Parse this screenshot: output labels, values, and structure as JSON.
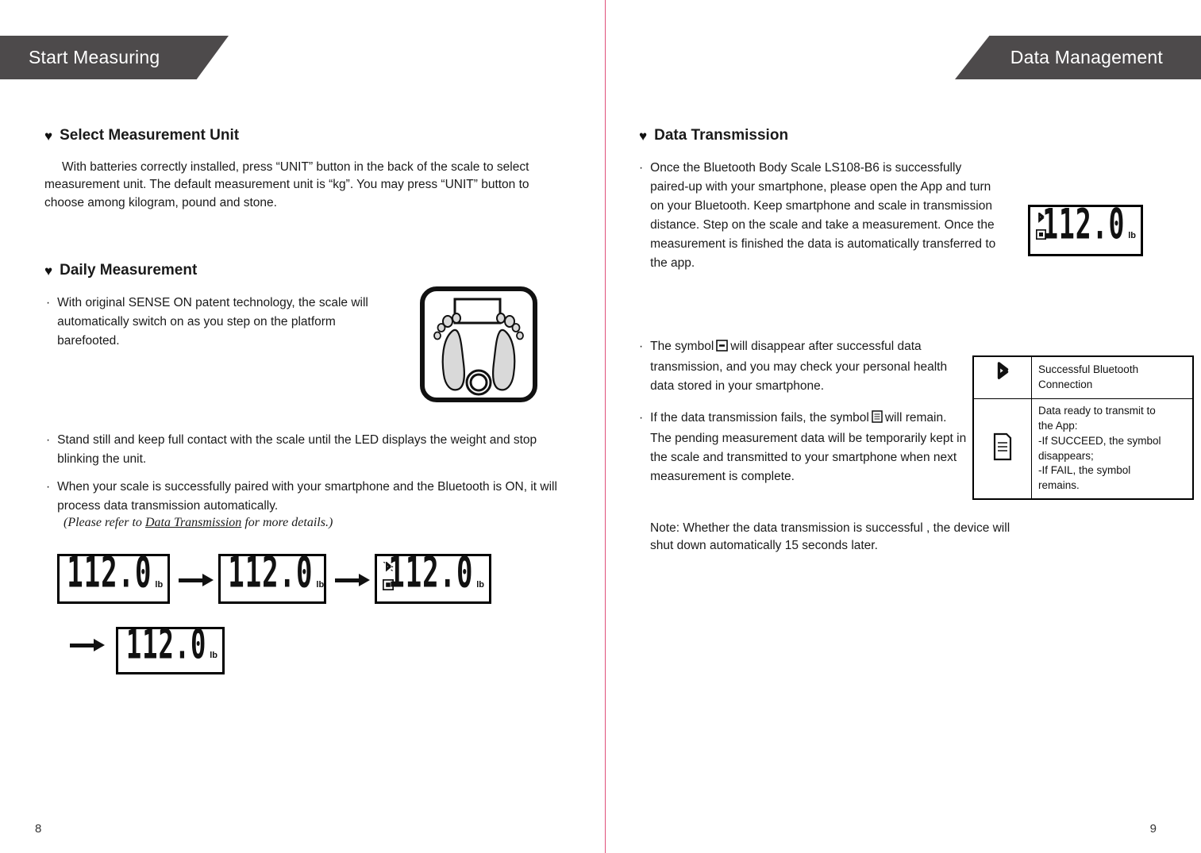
{
  "spread": {
    "left_page": {
      "banner_title": "Start Measuring",
      "page_number": "8",
      "sections": [
        {
          "heart": "♥",
          "heading": "Select Measurement Unit",
          "paragraph": "With batteries correctly installed, press “UNIT” button in the back of the scale to select measurement unit. The default measurement unit is “kg”. You may press “UNIT” button to choose among kilogram, pound and stone."
        },
        {
          "heart": "♥",
          "heading": "Daily Measurement"
        }
      ],
      "bullets": [
        {
          "dot": "·",
          "text": "With original SENSE ON patent technology, the scale will automatically switch on as you step on the platform barefooted."
        },
        {
          "dot": "·",
          "text": "Stand still and keep full contact with the scale until the LED displays the weight and stop blinking the unit."
        },
        {
          "dot": "·",
          "text": "When your scale is successfully paired with your smartphone and the Bluetooth is ON, it will process data transmission automatically."
        }
      ],
      "reference_note": {
        "open_paren": "(",
        "before": "Please refer to ",
        "link": "Data Transmission",
        "after": " for more details.",
        "close_paren": ")"
      },
      "scale_illustration": {
        "icon_name": "bathroom-scale-with-feet-illustration",
        "display_label": "",
        "logo_label": ""
      },
      "lcd_sequence": [
        {
          "value": "112.0",
          "unit": "lb",
          "bluetooth": "none",
          "transmit": "none"
        },
        {
          "value": "112.0",
          "unit": "lb",
          "bluetooth": "none",
          "transmit": "none"
        },
        {
          "value": "112.0",
          "unit": "lb",
          "bluetooth": "blinking",
          "transmit": "filled"
        },
        {
          "value": "112.0",
          "unit": "lb",
          "bluetooth": "none",
          "transmit": "none"
        }
      ]
    },
    "right_page": {
      "banner_title": "Data Management",
      "page_number": "9",
      "section": {
        "heart": "♥",
        "heading": "Data Transmission"
      },
      "bullets": [
        {
          "dot": "·",
          "text": "Once the Bluetooth Body Scale LS108-B6 is successfully paired-up with your smartphone, please open the App and turn on your Bluetooth. Keep smartphone and scale in transmission distance. Step on the scale and take a measurement. Once the measurement is finished the data is automatically transferred to the app."
        },
        {
          "dot": "·",
          "text_before": "The symbol",
          "symbol": "transmit-icon",
          "text_after": "will disappear after successful data transmission, and you may check your personal health data stored in your smartphone."
        },
        {
          "dot": "·",
          "text_before": "If the data transmission fails, the symbol",
          "symbol": "document-icon",
          "text_after": "will remain. The pending measurement data will be temporarily kept in the scale and transmitted to your smartphone when next measurement is complete."
        }
      ],
      "note": "Note: Whether the data transmission is successful , the device will shut down automatically 15 seconds later.",
      "lcd": {
        "value": "112.0",
        "unit": "lb",
        "bluetooth": "solid",
        "transmit": "solid"
      },
      "legend_table": {
        "rows": [
          {
            "icon_name": "bluetooth-icon",
            "lines": [
              "Successful Bluetooth",
              "Connection"
            ]
          },
          {
            "icon_name": "document-transmit-icon",
            "lines": [
              "Data ready to transmit to",
              "the App:",
              "-If SUCCEED, the symbol",
              "disappears;",
              "-If FAIL, the symbol",
              "remains."
            ]
          }
        ]
      }
    }
  },
  "colors": {
    "banner_background": "#4d4a4b",
    "banner_text": "#ffffff",
    "divider": "#e0507a",
    "body_text": "#1a1a1a",
    "page_background": "#ffffff"
  }
}
